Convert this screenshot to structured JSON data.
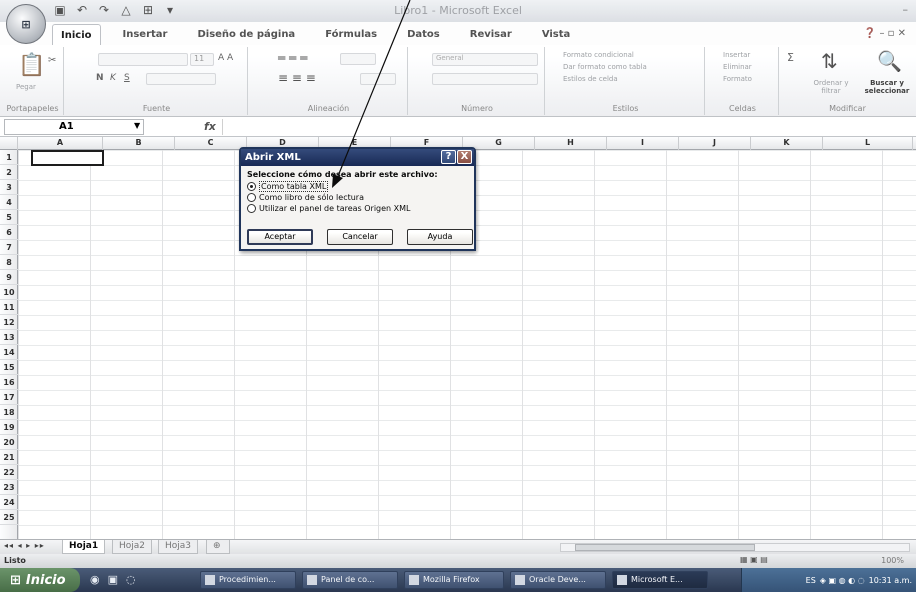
{
  "window": {
    "title": "Libro1 - Microsoft Excel",
    "min": "–",
    "max": "□",
    "close": "x"
  },
  "office_button": {
    "label": "Office"
  },
  "ribbon": {
    "tabs": [
      "Inicio",
      "Insertar",
      "Diseño de página",
      "Fórmulas",
      "Datos",
      "Revisar",
      "Vista"
    ],
    "groups": {
      "portapapeles": {
        "label": "Portapapeles",
        "paste": "Pegar"
      },
      "fuente": {
        "label": "Fuente",
        "size": "11"
      },
      "alineacion": {
        "label": "Alineación"
      },
      "numero": {
        "label": "Número",
        "format": "General"
      },
      "estilos": {
        "label": "Estilos",
        "items": [
          "Formato condicional",
          "Dar formato como tabla",
          "Estilos de celda"
        ]
      },
      "celdas": {
        "label": "Celdas",
        "items": [
          "Insertar",
          "Eliminar",
          "Formato"
        ]
      },
      "modificar": {
        "label": "Modificar",
        "sort": "Ordenar y filtrar",
        "find": "Buscar y seleccionar"
      }
    }
  },
  "formula_bar": {
    "name_box": "A1",
    "fx": "fx",
    "content": ""
  },
  "grid": {
    "columns": [
      "A",
      "B",
      "C",
      "D",
      "E",
      "F",
      "G",
      "H",
      "I",
      "J",
      "K",
      "L"
    ],
    "rows": [
      "1",
      "2",
      "3",
      "4",
      "5",
      "6",
      "7",
      "8",
      "9",
      "10",
      "11",
      "12",
      "13",
      "14",
      "15",
      "16",
      "17",
      "18",
      "19",
      "20",
      "21",
      "22",
      "23",
      "24",
      "25"
    ],
    "active_cell": "A1"
  },
  "sheets": {
    "nav": "◂◂ ◂ ▸ ▸▸",
    "tabs": [
      "Hoja1",
      "Hoja2",
      "Hoja3"
    ],
    "active": "Hoja1"
  },
  "status": {
    "text": "Listo",
    "zoom": "100%"
  },
  "dialog": {
    "title": "Abrir XML",
    "prompt": "Seleccione cómo desea abrir este archivo:",
    "options": [
      {
        "label": "Como tabla XML",
        "selected": true
      },
      {
        "label": "Como libro de sólo lectura",
        "selected": false
      },
      {
        "label": "Utilizar el panel de tareas Origen XML",
        "selected": false
      }
    ],
    "buttons": {
      "ok": "Aceptar",
      "cancel": "Cancelar",
      "help": "Ayuda"
    },
    "title_help": "?",
    "title_close": "X"
  },
  "taskbar": {
    "start": "Inicio",
    "items": [
      "Procedimien...",
      "Panel de co...",
      "Mozilla Firefox",
      "Oracle Deve...",
      "Microsoft E..."
    ],
    "tray_lang": "ES",
    "clock": "10:31 a.m."
  },
  "colors": {
    "dialog_title": "#0a2e8a",
    "taskbar": "#1f3c70",
    "start": "#2b7a2a"
  }
}
